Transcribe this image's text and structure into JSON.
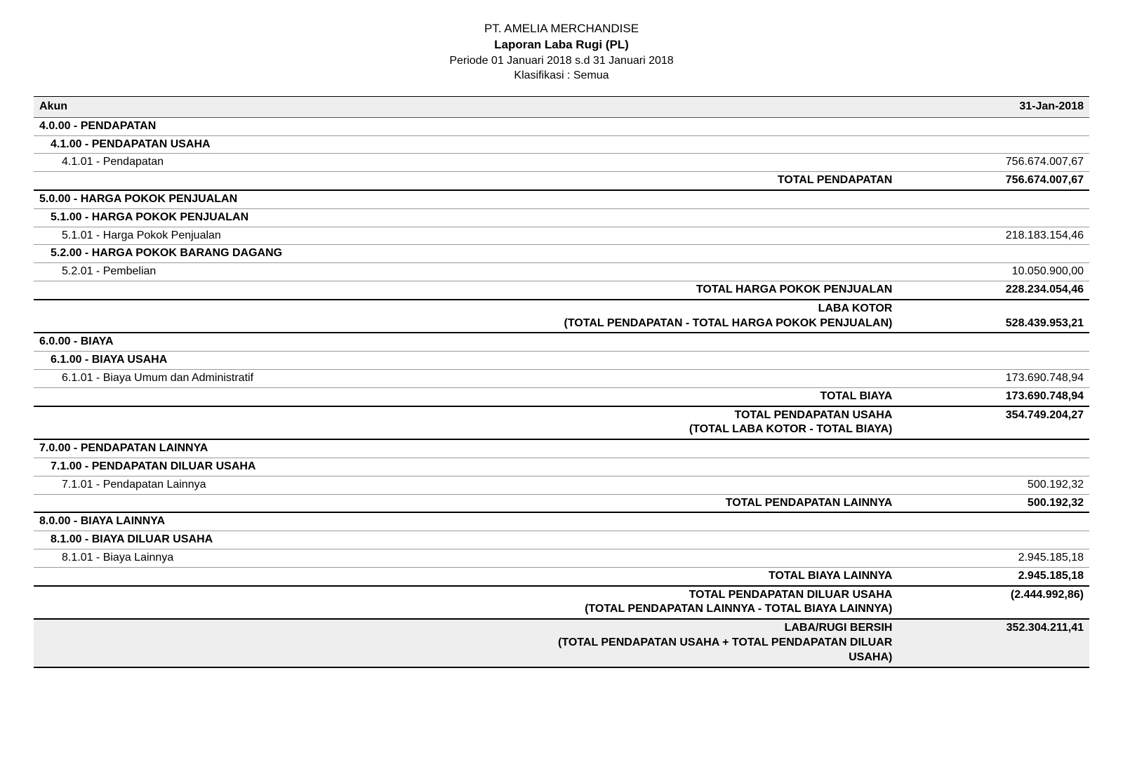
{
  "header": {
    "company": "PT. AMELIA MERCHANDISE",
    "title": "Laporan Laba Rugi (PL)",
    "period": "Periode 01 Januari 2018 s.d 31 Januari 2018",
    "classification": "Klasifikasi : Semua"
  },
  "columns": {
    "account": "Akun",
    "date": "31-Jan-2018"
  },
  "sections": {
    "pendapatan": {
      "h1": "4.0.00 - PENDAPATAN",
      "h2": "4.1.00 - PENDAPATAN USAHA",
      "r1_label": "4.1.01 - Pendapatan",
      "r1_value": "756.674.007,67",
      "total_label": "TOTAL PENDAPATAN",
      "total_value": "756.674.007,67"
    },
    "hpp": {
      "h1": "5.0.00 - HARGA POKOK PENJUALAN",
      "h2": "5.1.00 - HARGA POKOK PENJUALAN",
      "r1_label": "5.1.01 - Harga Pokok Penjualan",
      "r1_value": "218.183.154,46",
      "h3": "5.2.00 - HARGA POKOK BARANG DAGANG",
      "r2_label": "5.2.01 - Pembelian",
      "r2_value": "10.050.900,00",
      "total_label": "TOTAL HARGA POKOK PENJUALAN",
      "total_value": "228.234.054,46"
    },
    "laba_kotor": {
      "label1": "LABA KOTOR",
      "label2": "(TOTAL PENDAPATAN - TOTAL HARGA POKOK PENJUALAN)",
      "value": "528.439.953,21"
    },
    "biaya": {
      "h1": "6.0.00 - BIAYA",
      "h2": "6.1.00 - BIAYA USAHA",
      "r1_label": "6.1.01 - Biaya Umum dan Administratif",
      "r1_value": "173.690.748,94",
      "total_label": "TOTAL BIAYA",
      "total_value": "173.690.748,94"
    },
    "pendapatan_usaha": {
      "label1": "TOTAL PENDAPATAN USAHA",
      "label2": "(TOTAL LABA KOTOR - TOTAL BIAYA)",
      "value": "354.749.204,27"
    },
    "pendapatan_lainnya": {
      "h1": "7.0.00 - PENDAPATAN LAINNYA",
      "h2": "7.1.00 - PENDAPATAN DILUAR USAHA",
      "r1_label": "7.1.01 - Pendapatan Lainnya",
      "r1_value": "500.192,32",
      "total_label": "TOTAL PENDAPATAN LAINNYA",
      "total_value": "500.192,32"
    },
    "biaya_lainnya": {
      "h1": "8.0.00 - BIAYA LAINNYA",
      "h2": "8.1.00 - BIAYA DILUAR USAHA",
      "r1_label": "8.1.01 - Biaya Lainnya",
      "r1_value": "2.945.185,18",
      "total_label": "TOTAL BIAYA LAINNYA",
      "total_value": "2.945.185,18"
    },
    "pendapatan_diluar_usaha": {
      "label1": "TOTAL PENDAPATAN DILUAR USAHA",
      "label2": "(TOTAL PENDAPATAN LAINNYA - TOTAL BIAYA LAINNYA)",
      "value": "(2.444.992,86)"
    },
    "laba_bersih": {
      "label1": "LABA/RUGI BERSIH",
      "label2": "(TOTAL PENDAPATAN USAHA + TOTAL PENDAPATAN DILUAR USAHA)",
      "value": "352.304.211,41"
    }
  }
}
